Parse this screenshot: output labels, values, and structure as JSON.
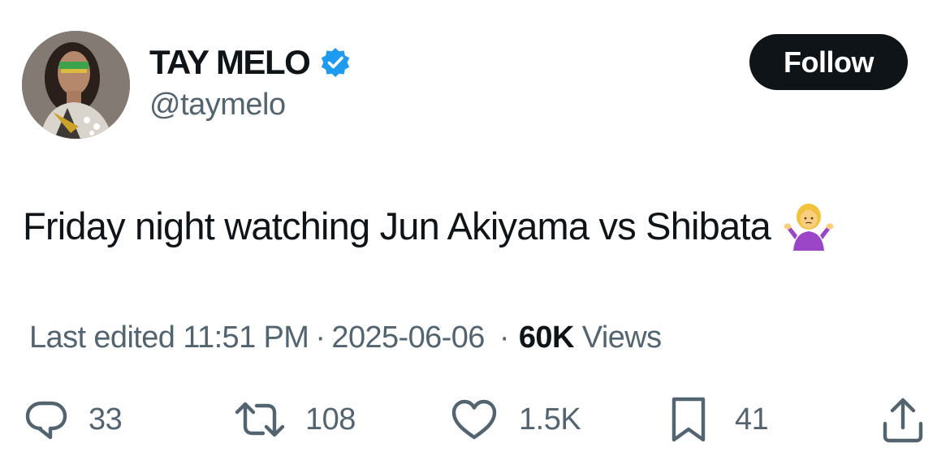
{
  "author": {
    "display_name": "TAY MELO",
    "handle": "@taymelo",
    "verified": true,
    "avatar_icon": "profile-photo"
  },
  "follow_button": {
    "label": "Follow"
  },
  "tweet": {
    "text": "Friday night watching Jun Akiyama vs Shibata",
    "emoji": "person-shrugging"
  },
  "meta": {
    "edited_label": "Last edited",
    "time": "11:51 PM",
    "separator": "·",
    "date": "2025-06-06",
    "views_count": "60K",
    "views_label": "Views"
  },
  "actions": {
    "replies": {
      "count": "33",
      "icon": "reply-icon"
    },
    "reposts": {
      "count": "108",
      "icon": "repost-icon"
    },
    "likes": {
      "count": "1.5K",
      "icon": "heart-icon"
    },
    "bookmarks": {
      "count": "41",
      "icon": "bookmark-icon"
    },
    "share": {
      "icon": "share-icon"
    }
  },
  "colors": {
    "text_primary": "#0f1419",
    "text_secondary": "#536471",
    "verified_blue": "#1d9bf0",
    "follow_bg": "#0f1419"
  }
}
